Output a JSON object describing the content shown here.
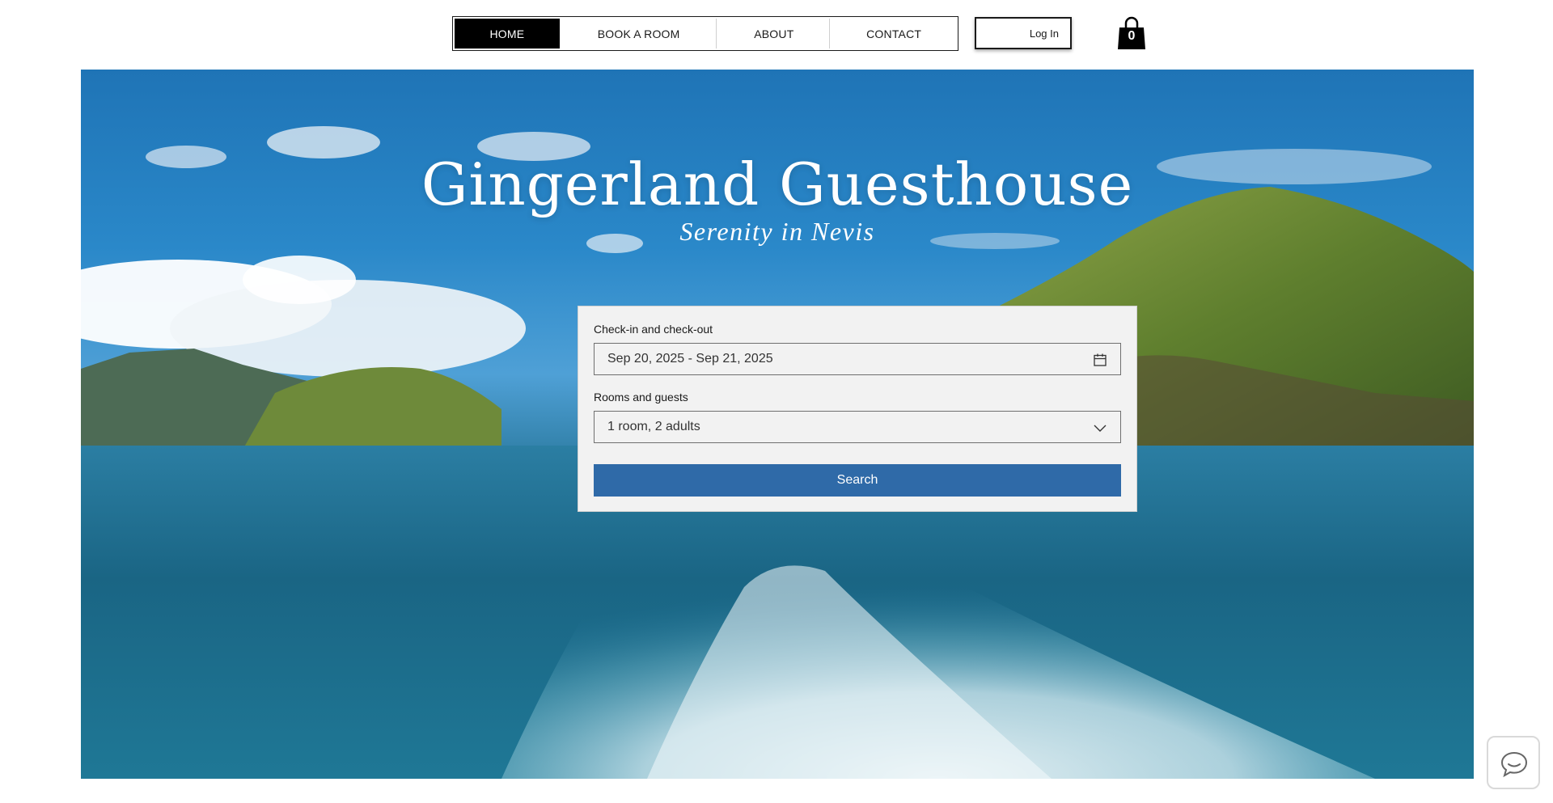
{
  "nav": {
    "items": [
      {
        "label": "HOME",
        "active": true
      },
      {
        "label": "BOOK A ROOM",
        "active": false
      },
      {
        "label": "ABOUT",
        "active": false
      },
      {
        "label": "CONTACT",
        "active": false
      }
    ],
    "login_label": "Log In",
    "cart_count": "0",
    "cart_icon": "shopping-bag-icon"
  },
  "hero": {
    "title": "Gingerland Guesthouse",
    "subtitle": "Serenity in Nevis"
  },
  "booking": {
    "dates_label": "Check-in and check-out",
    "dates_value": "Sep 20, 2025 - Sep 21, 2025",
    "dates_icon": "calendar-icon",
    "guests_label": "Rooms and guests",
    "guests_value": "1 room, 2 adults",
    "guests_icon": "chevron-down-icon",
    "search_label": "Search"
  },
  "chat": {
    "icon": "chat-bubble-icon"
  },
  "colors": {
    "nav_active_bg": "#000000",
    "search_button": "#2f6aa8",
    "widget_bg": "#f2f2f2"
  }
}
